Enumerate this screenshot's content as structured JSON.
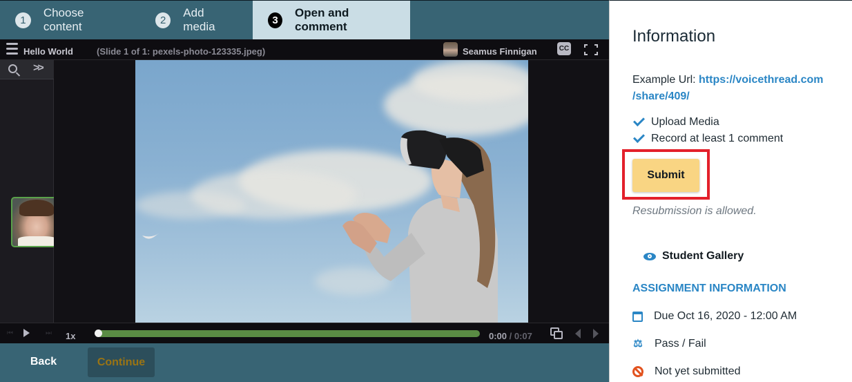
{
  "steps": [
    {
      "number": "1",
      "label": "Choose content",
      "active": false
    },
    {
      "number": "2",
      "label": "Add media",
      "active": false
    },
    {
      "number": "3",
      "label": "Open and comment",
      "active": true
    }
  ],
  "player": {
    "menu_icon": "hamburger-icon",
    "title": "Hello World",
    "slide_info": "(Slide 1 of 1: pexels-photo-123335.jpeg)",
    "user_name": "Seamus Finnigan",
    "cc_label": "CC",
    "speed": "1x",
    "progress_percent": 0,
    "time_current": "0:00",
    "time_separator": " / ",
    "time_total": "0:07",
    "expand_label": ">>"
  },
  "footer": {
    "back_label": "Back",
    "continue_label": "Continue"
  },
  "info": {
    "title": "Information",
    "url_label": "Example Url: ",
    "url_line1": "https://voicethread.com",
    "url_line2": "/share/409/",
    "requirements": [
      "Upload Media",
      "Record at least 1 comment"
    ],
    "submit_label": "Submit",
    "resubmission_note": "Resubmission is allowed.",
    "gallery_label": "Student Gallery",
    "assignment_heading": "ASSIGNMENT INFORMATION",
    "due": "Due Oct 16, 2020 - 12:00 AM",
    "grading": "Pass / Fail",
    "status": "Not yet submitted",
    "scale_glyph": "⚖"
  },
  "colors": {
    "accent_blue": "#2a86c5",
    "highlight_red": "#e3202b",
    "submit_yellow": "#f9d583",
    "progress_green": "#5a8c44",
    "status_orange": "#e2531f"
  }
}
